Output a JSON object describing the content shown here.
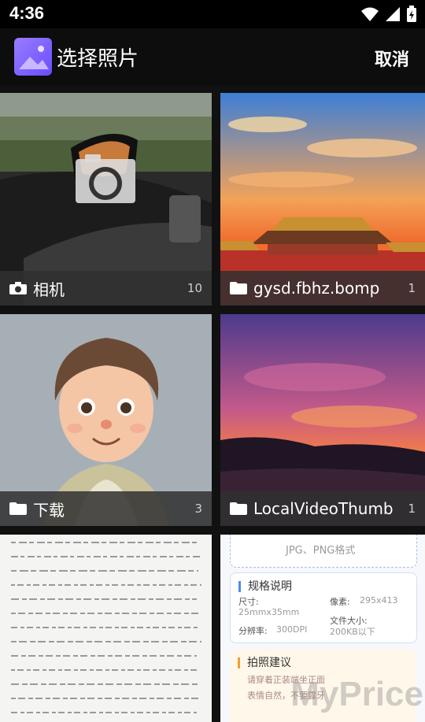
{
  "status_bar": {
    "time": "4:36",
    "icons": [
      "wifi-icon",
      "signal-icon",
      "battery-charging-icon"
    ]
  },
  "app_bar": {
    "title": "选择照片",
    "cancel_label": "取消",
    "icon": "gallery-app-icon"
  },
  "albums": [
    {
      "name": "相机",
      "count": "10",
      "icon": "camera-icon"
    },
    {
      "name": "gysd.fbhz.bomp",
      "count": "1",
      "icon": "folder-icon"
    },
    {
      "name": "下载",
      "count": "3",
      "icon": "folder-icon"
    },
    {
      "name": "LocalVideoThumb",
      "count": "1",
      "icon": "folder-icon"
    }
  ],
  "partial_tiles": {
    "doc_left": "handwritten-page",
    "doc_right": {
      "format_text": "JPG、PNG格式",
      "spec_title": "规格说明",
      "size_label": "尺寸:",
      "size_value": "25mmx35mm",
      "pixels_label": "像素:",
      "pixels_value": "295x413",
      "dpi_label": "分辨率:",
      "dpi_value": "300DPI",
      "filesize_label": "文件大小:",
      "filesize_value": "200KB以下",
      "tips_title": "拍照建议",
      "tip1": "请穿着正装端坐正面",
      "tip2": "表情自然，不要露牙",
      "watermark": "MyPrice"
    }
  }
}
